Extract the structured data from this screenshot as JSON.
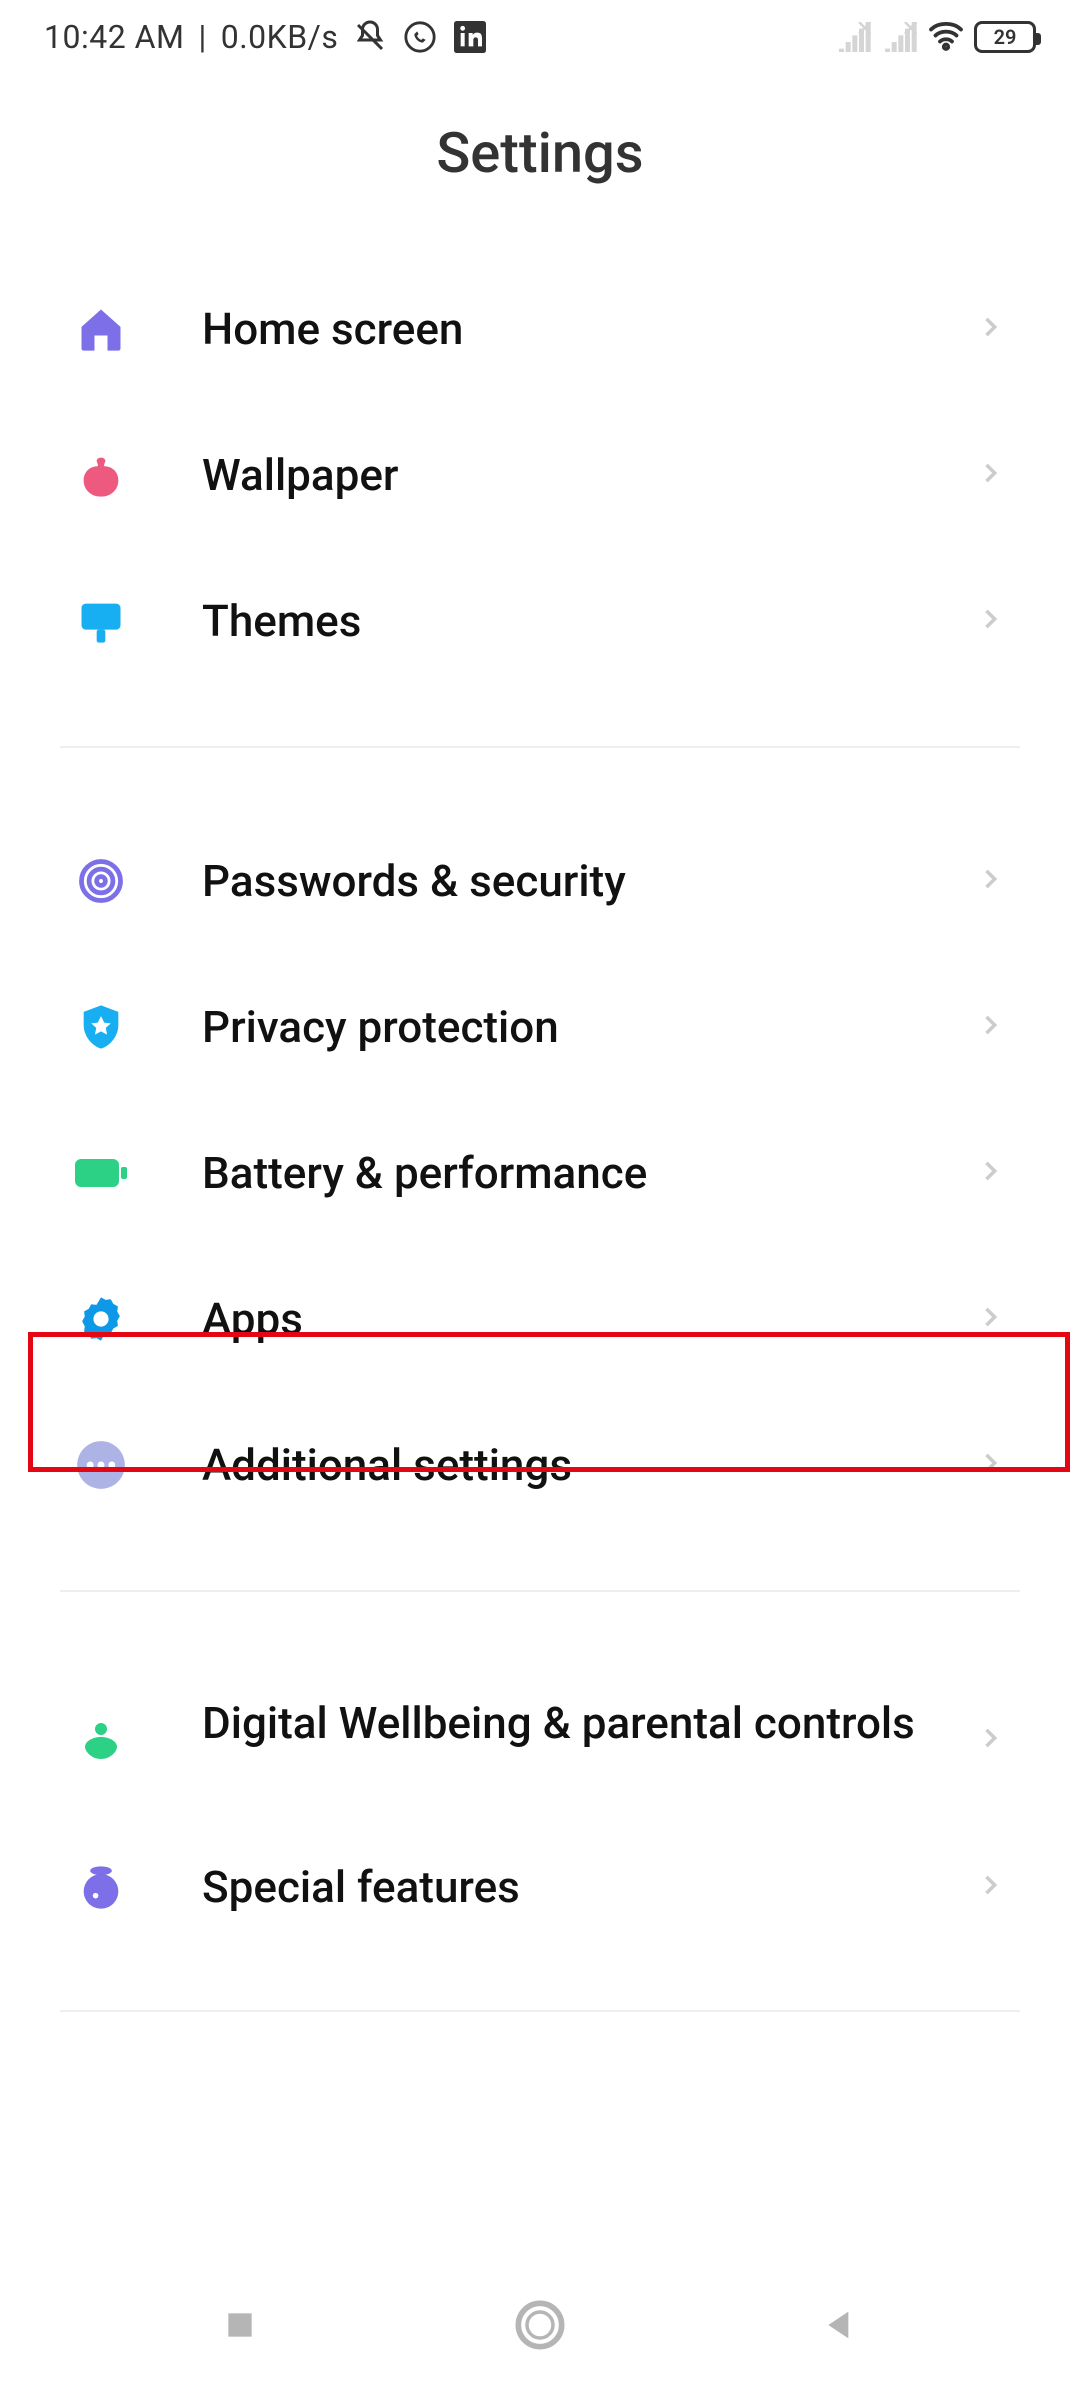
{
  "status": {
    "time": "10:42 AM",
    "separator": "|",
    "speed": "0.0KB/s",
    "battery_level": "29"
  },
  "title": "Settings",
  "groups": [
    {
      "items": [
        {
          "id": "home-screen",
          "label": "Home screen"
        },
        {
          "id": "wallpaper",
          "label": "Wallpaper"
        },
        {
          "id": "themes",
          "label": "Themes"
        }
      ]
    },
    {
      "items": [
        {
          "id": "passwords-security",
          "label": "Passwords & security"
        },
        {
          "id": "privacy-protection",
          "label": "Privacy protection"
        },
        {
          "id": "battery-performance",
          "label": "Battery & performance"
        },
        {
          "id": "apps",
          "label": "Apps"
        },
        {
          "id": "additional-settings",
          "label": "Additional settings"
        }
      ]
    },
    {
      "items": [
        {
          "id": "digital-wellbeing",
          "label": "Digital Wellbeing & parental controls"
        },
        {
          "id": "special-features",
          "label": "Special features"
        }
      ]
    }
  ]
}
